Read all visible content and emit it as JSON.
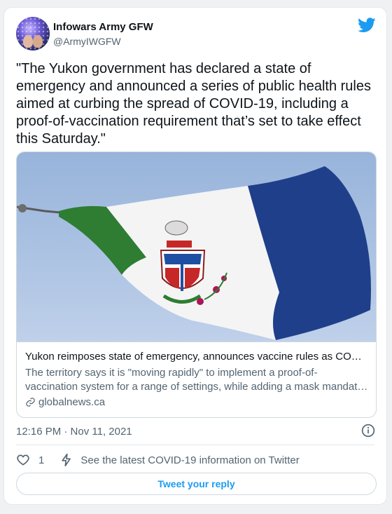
{
  "author": {
    "name": "Infowars Army GFW",
    "handle": "@ArmyIWGFW"
  },
  "tweet": {
    "text": "\"The Yukon government has declared a state of emergency and announced a series of public health rules aimed at curbing the spread of COVID-19, including a proof-of-vaccination requirement that’s set to take effect this Saturday.\"",
    "timestamp": "12:16 PM · Nov 11, 2021"
  },
  "link_card": {
    "title": "Yukon reimposes state of emergency, announces vaccine rules as CO…",
    "description": "The territory says it is \"moving rapidly\" to implement a proof-of-vaccination system for a range of settings, while adding a mask mandat…",
    "domain": "globalnews.ca",
    "image_icon": "yukon-flag-image"
  },
  "engagement": {
    "like_count": "1",
    "covid_info": "See the latest COVID-19 information on Twitter"
  },
  "reply_button_label": "Tweet your reply",
  "icons": {
    "brand": "twitter-bird-icon",
    "info": "info-icon",
    "like": "heart-icon",
    "covid": "lightning-bolt-icon",
    "link": "link-icon"
  },
  "colors": {
    "accent": "#1d9bf0",
    "text_primary": "#0f1419",
    "text_secondary": "#536471",
    "border": "#cfd9de",
    "flag_green": "#2e7d32",
    "flag_white": "#f4f4f4",
    "flag_blue": "#1f3f8a"
  }
}
